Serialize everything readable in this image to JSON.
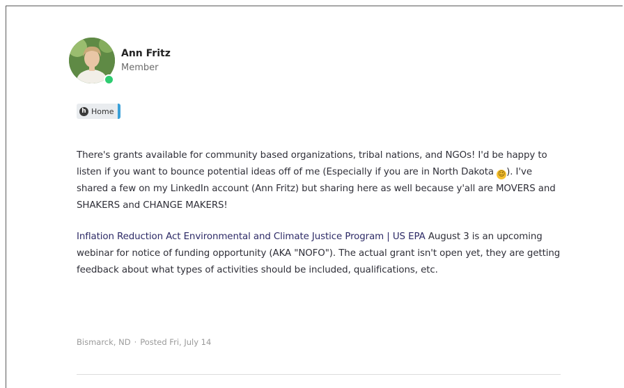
{
  "author": {
    "name": "Ann Fritz",
    "role": "Member",
    "status_color": "#2ecc71"
  },
  "tag": {
    "icon_letter": "h",
    "label": "Home",
    "accent": "#3aa0d8"
  },
  "post": {
    "p1_a": "There's grants available for community based organizations, tribal nations, and NGOs!  I'd be happy to listen if you want to bounce potential ideas off of me (Especially if you are in North Dakota ",
    "emoji": "😉",
    "p1_b": ").  I've shared a few on my LinkedIn account (Ann Fritz) but sharing here as well because y'all are MOVERS and SHAKERS and CHANGE MAKERS!",
    "link_text": "Inflation Reduction Act Environmental and Climate Justice Program | US EPA",
    "p2_rest": " August 3 is an upcoming webinar for notice of funding opportunity (AKA \"NOFO\").  The actual grant isn't open yet, they are getting feedback about what types of activities should be included, qualifications, etc."
  },
  "meta": {
    "location": "Bismarck, ND",
    "separator": "·",
    "posted": "Posted Fri, July 14"
  }
}
